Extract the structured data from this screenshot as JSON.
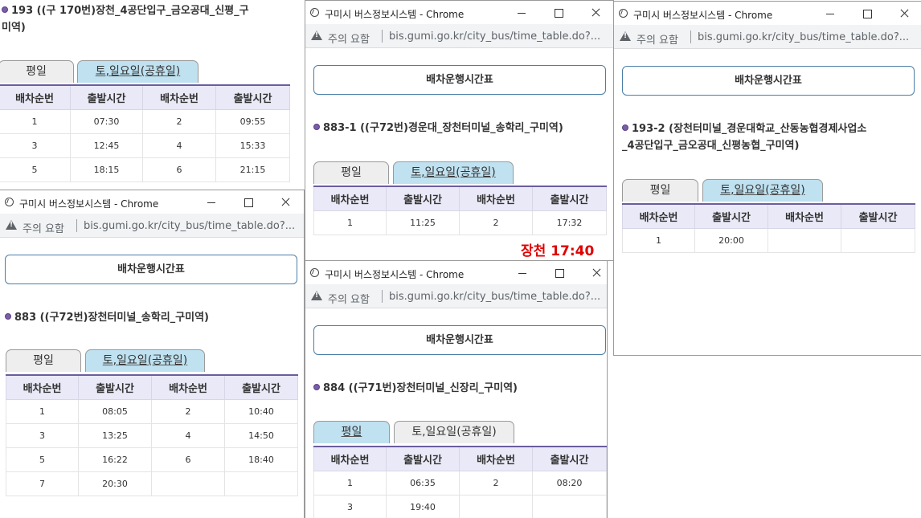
{
  "common": {
    "window_title": "구미시 버스정보시스템 - Chrome",
    "caution": "주의 요함",
    "url": "bis.gumi.go.kr/city_bus/time_table.do?...",
    "page_button": "배차운행시간표",
    "tab_weekday": "평일",
    "tab_holiday": "토,일요일(공휴일)",
    "col_seq": "배차순번",
    "col_time": "출발시간"
  },
  "w193": {
    "route_line1": "193 ((구 170번)장천_4공단입구_금오공대_신평_구",
    "route_line2": "미역)",
    "rows": [
      [
        "1",
        "07:30",
        "2",
        "09:55"
      ],
      [
        "3",
        "12:45",
        "4",
        "15:33"
      ],
      [
        "5",
        "18:15",
        "6",
        "21:15"
      ]
    ]
  },
  "w883": {
    "route": "883 ((구72번)장천터미널_송학리_구미역)",
    "rows": [
      [
        "1",
        "08:05",
        "2",
        "10:40"
      ],
      [
        "3",
        "13:25",
        "4",
        "14:50"
      ],
      [
        "5",
        "16:22",
        "6",
        "18:40"
      ],
      [
        "7",
        "20:30",
        "",
        ""
      ]
    ]
  },
  "w8831": {
    "route": "883-1 ((구72번)경운대_장천터미널_송학리_구미역)",
    "rows": [
      [
        "1",
        "11:25",
        "2",
        "17:32"
      ]
    ]
  },
  "w884": {
    "route": "884 ((구71번)장천터미널_신장리_구미역)",
    "rows": [
      [
        "1",
        "06:35",
        "2",
        "08:20"
      ],
      [
        "3",
        "19:40",
        "",
        ""
      ]
    ]
  },
  "w1932": {
    "route_line1": "193-2 (장천터미널_경운대학교_산동농협경제사업소",
    "route_line2": "_4공단입구_금오공대_신평농협_구미역)",
    "rows": [
      [
        "1",
        "20:00",
        "",
        ""
      ]
    ]
  },
  "annotation": "장천 17:40",
  "colors": {
    "tab_active": "#bfe1f0",
    "header_bg": "#e9e9f7",
    "header_border": "#6b5d9e",
    "annotation": "#e00000",
    "bullet": "#7b5ea7"
  }
}
